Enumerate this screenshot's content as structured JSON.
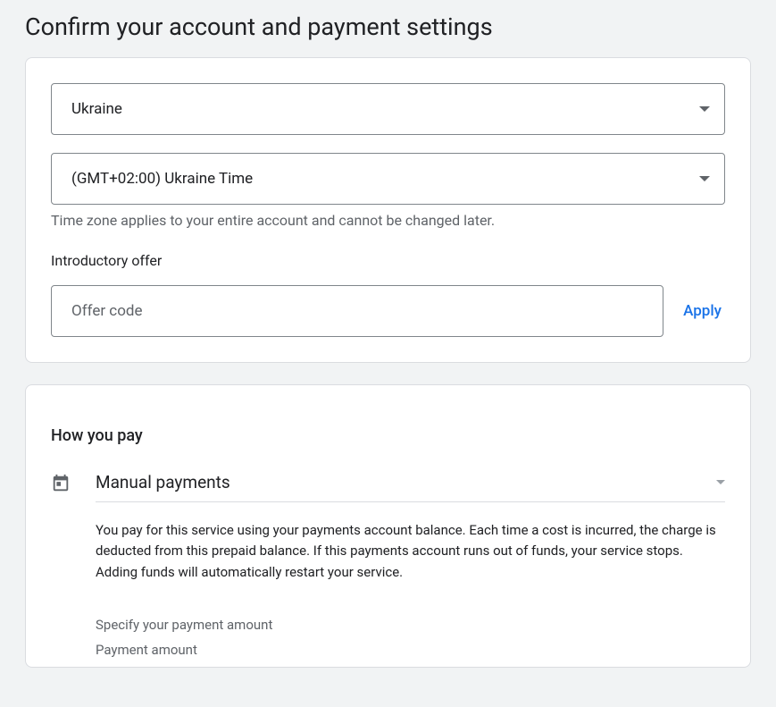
{
  "title": "Confirm your account and payment settings",
  "country": {
    "value": "Ukraine"
  },
  "timezone": {
    "value": "(GMT+02:00) Ukraine Time",
    "helper": "Time zone applies to your entire account and cannot be changed later."
  },
  "offer": {
    "label": "Introductory offer",
    "placeholder": "Offer code",
    "apply_label": "Apply"
  },
  "payment": {
    "heading": "How you pay",
    "method": "Manual payments",
    "description": "You pay for this service using your payments account balance. Each time a cost is incurred, the charge is deducted from this prepaid balance. If this payments account runs out of funds, your service stops. Adding funds will automatically restart your service.",
    "specify_label": "Specify your payment amount",
    "amount_label": "Payment amount"
  }
}
